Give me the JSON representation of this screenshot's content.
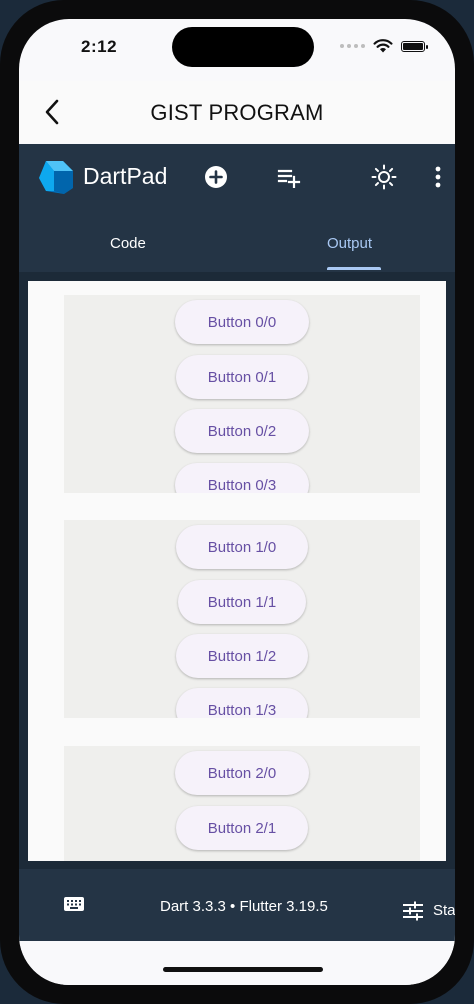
{
  "status_bar": {
    "time": "2:12"
  },
  "nav": {
    "title": "GIST PROGRAM",
    "back_icon": "chevron-left-icon"
  },
  "dartpad": {
    "app_name": "DartPad",
    "toolbar_icons": [
      "add-circle-icon",
      "playlist-add-icon",
      "brightness-icon",
      "more-vert-icon"
    ],
    "tabs": [
      {
        "label": "Code",
        "selected": false
      },
      {
        "label": "Output",
        "selected": true
      }
    ]
  },
  "output": {
    "groups": [
      {
        "buttons": [
          "Button 0/0",
          "Button 0/1",
          "Button 0/2",
          "Button 0/3"
        ]
      },
      {
        "buttons": [
          "Button 1/0",
          "Button 1/1",
          "Button 1/2",
          "Button 1/3"
        ]
      },
      {
        "buttons": [
          "Button 2/0",
          "Button 2/1"
        ]
      }
    ]
  },
  "footer": {
    "version": "Dart 3.3.3 • Flutter 3.19.5",
    "channel": "Stable"
  },
  "colors": {
    "app_bar": "#243445",
    "tab_selected": "#a9c8f3",
    "button_text": "#6750a4",
    "button_bg": "#f6f2fa"
  }
}
